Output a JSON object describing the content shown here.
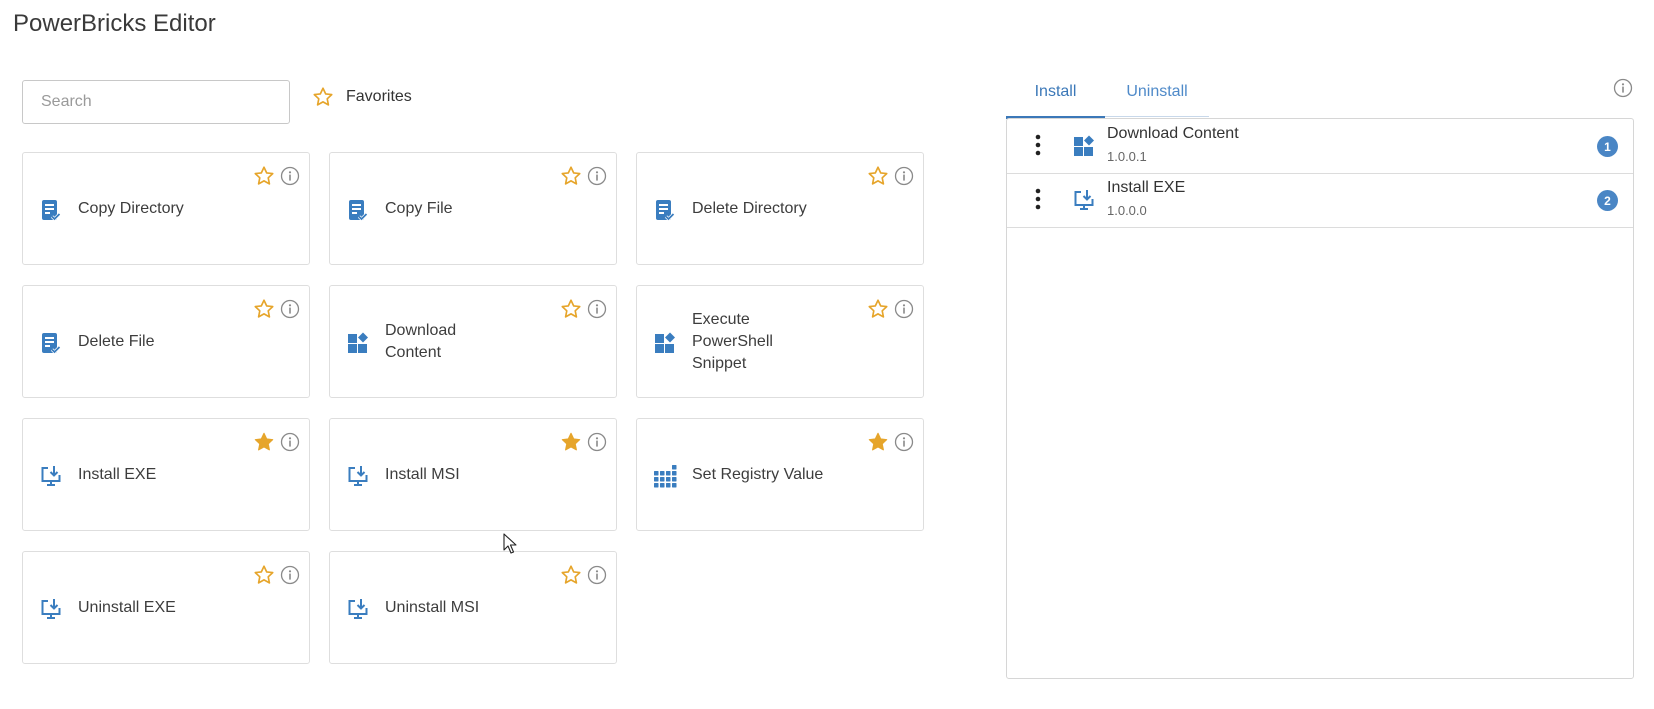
{
  "app": {
    "title": "PowerBricks Editor"
  },
  "search": {
    "placeholder": "Search",
    "value": ""
  },
  "favorites": {
    "label": "Favorites",
    "icon": "star-outline-icon"
  },
  "colors": {
    "accent": "#3b78b8",
    "icon_blue": "#3a7dbf",
    "star": "#e6a52b",
    "badge": "#4a86c5"
  },
  "bricks": [
    {
      "label": "Copy Directory",
      "icon": "file-check-icon",
      "favorite": false
    },
    {
      "label": "Copy File",
      "icon": "file-check-icon",
      "favorite": false
    },
    {
      "label": "Delete Directory",
      "icon": "file-check-icon",
      "favorite": false
    },
    {
      "label": "Delete File",
      "icon": "file-check-icon",
      "favorite": false
    },
    {
      "label": "Download Content",
      "icon": "widgets-icon",
      "favorite": false
    },
    {
      "label": "Execute PowerShell Snippet",
      "icon": "widgets-icon",
      "favorite": false
    },
    {
      "label": "Install EXE",
      "icon": "install-icon",
      "favorite": true
    },
    {
      "label": "Install MSI",
      "icon": "install-icon",
      "favorite": true
    },
    {
      "label": "Set Registry Value",
      "icon": "grid-dots-icon",
      "favorite": true
    },
    {
      "label": "Uninstall EXE",
      "icon": "install-icon",
      "favorite": false
    },
    {
      "label": "Uninstall MSI",
      "icon": "install-icon",
      "favorite": false
    }
  ],
  "tabs": [
    {
      "label": "Install",
      "active": true
    },
    {
      "label": "Uninstall",
      "active": false
    }
  ],
  "sequence": [
    {
      "name": "Download Content",
      "version": "1.0.0.1",
      "order": "1",
      "icon": "widgets-icon"
    },
    {
      "name": "Install EXE",
      "version": "1.0.0.0",
      "order": "2",
      "icon": "install-icon"
    }
  ]
}
